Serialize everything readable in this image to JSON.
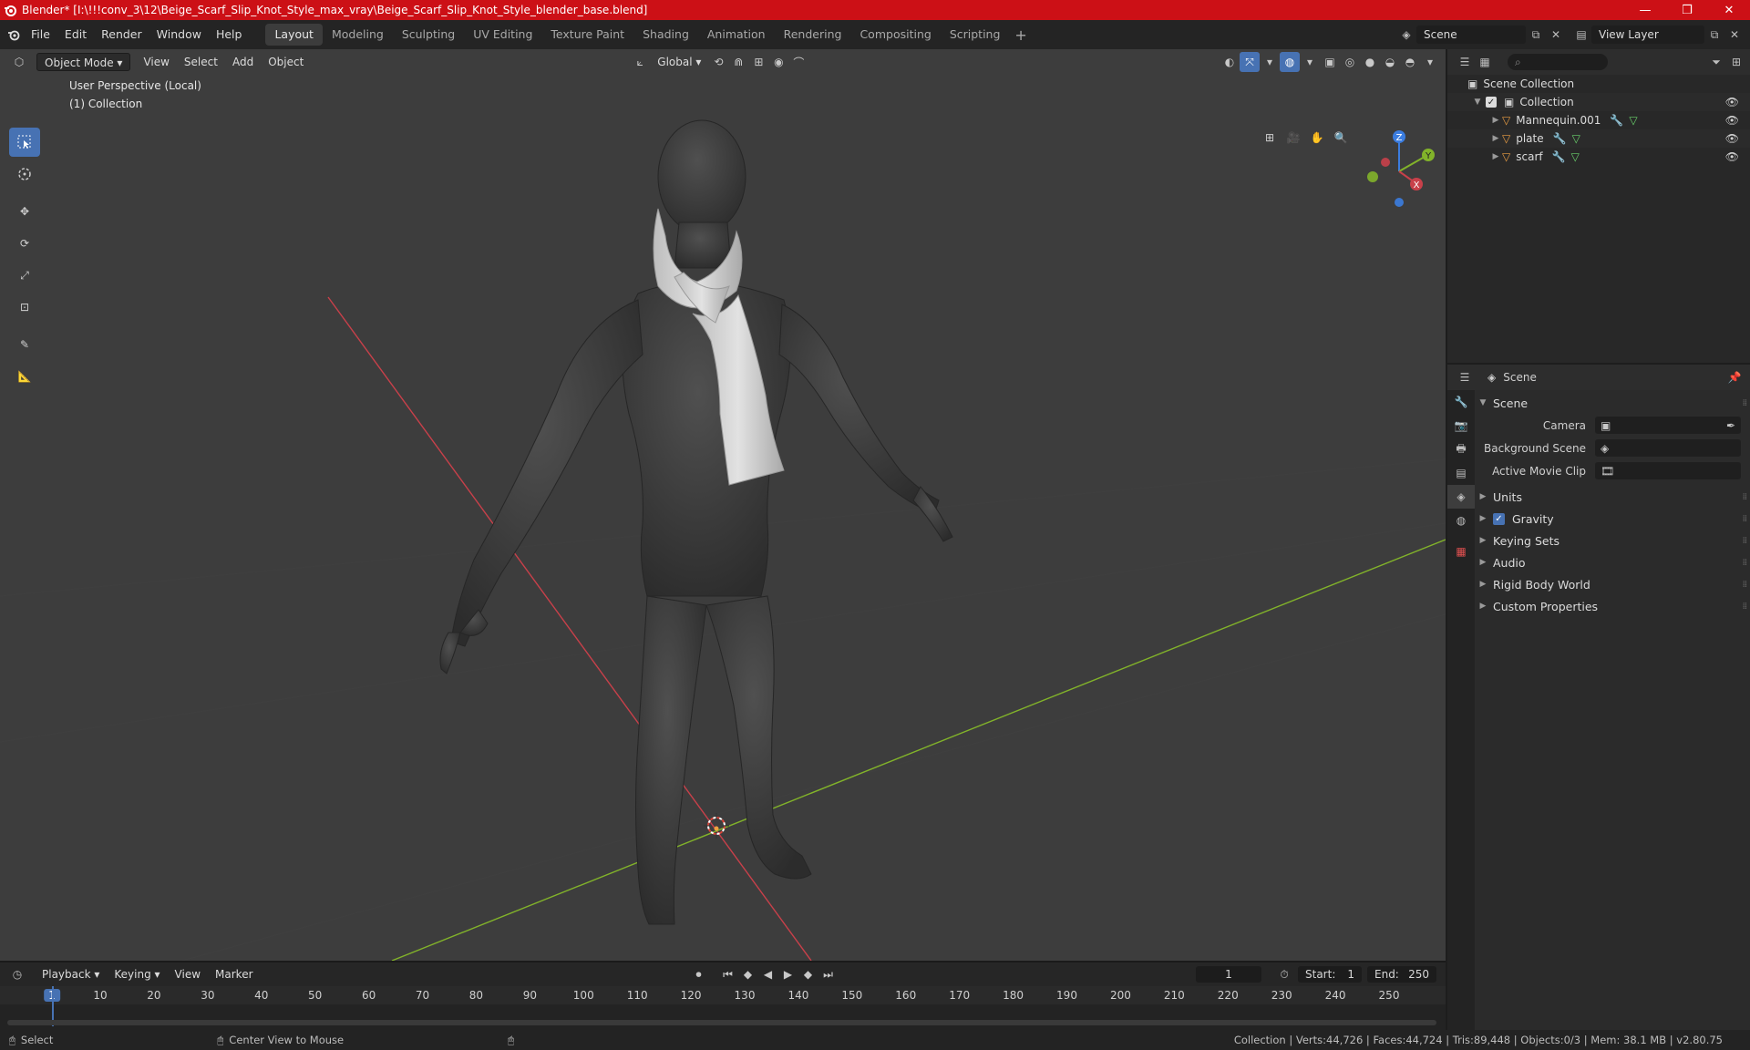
{
  "window": {
    "title": "Blender* [I:\\!!!conv_3\\12\\Beige_Scarf_Slip_Knot_Style_max_vray\\Beige_Scarf_Slip_Knot_Style_blender_base.blend]",
    "minimize": "—",
    "maximize": "❒",
    "close": "✕"
  },
  "menus": [
    "File",
    "Edit",
    "Render",
    "Window",
    "Help"
  ],
  "workspaces": [
    "Layout",
    "Modeling",
    "Sculpting",
    "UV Editing",
    "Texture Paint",
    "Shading",
    "Animation",
    "Rendering",
    "Compositing",
    "Scripting"
  ],
  "active_workspace": "Layout",
  "scene_selector": "Scene",
  "view_layer": "View Layer",
  "viewport": {
    "mode": "Object Mode",
    "menus": [
      "View",
      "Select",
      "Add",
      "Object"
    ],
    "transform_orientation": "Global",
    "info_line1": "User Perspective (Local)",
    "info_line2": "(1) Collection"
  },
  "gizmo": {
    "z": "Z",
    "y": "Y",
    "x": "X"
  },
  "outliner": {
    "search_placeholder": "",
    "root": "Scene Collection",
    "collection": "Collection",
    "objects": [
      "Mannequin.001",
      "plate",
      "scarf"
    ]
  },
  "properties": {
    "header": "Scene",
    "panel_scene": "Scene",
    "camera_label": "Camera",
    "background_label": "Background Scene",
    "movieclip_label": "Active Movie Clip",
    "panels": [
      "Units",
      "Gravity",
      "Keying Sets",
      "Audio",
      "Rigid Body World",
      "Custom Properties"
    ]
  },
  "timeline": {
    "menus": [
      "Playback",
      "Keying",
      "View",
      "Marker"
    ],
    "current_frame": "1",
    "start_label": "Start:",
    "start": "1",
    "end_label": "End:",
    "end": "250",
    "ticks": [
      "1",
      "10",
      "20",
      "30",
      "40",
      "50",
      "60",
      "70",
      "80",
      "90",
      "100",
      "110",
      "120",
      "130",
      "140",
      "150",
      "160",
      "170",
      "180",
      "190",
      "200",
      "210",
      "220",
      "230",
      "240",
      "250"
    ]
  },
  "statusbar": {
    "left": "Select",
    "middle": "Center View to Mouse",
    "stats": "Collection | Verts:44,726 | Faces:44,724 | Tris:89,448 | Objects:0/3 | Mem: 38.1 MB | v2.80.75"
  },
  "colors": {
    "titlebar": "#cc1016",
    "accent": "#4772b3",
    "x_axis": "#c8404a",
    "y_axis": "#82b32a",
    "z_axis": "#3b7de0",
    "mesh_icon": "#e89c43"
  }
}
